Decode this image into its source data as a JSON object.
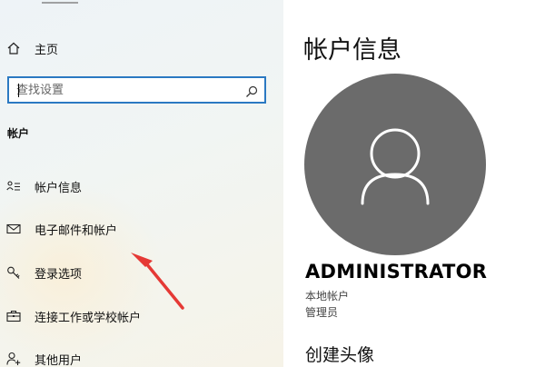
{
  "sidebar": {
    "home_label": "主页",
    "search": {
      "placeholder": "查找设置"
    },
    "section_title": "帐户",
    "items": [
      {
        "label": "帐户信息",
        "icon": "account-info-icon"
      },
      {
        "label": "电子邮件和帐户",
        "icon": "mail-icon"
      },
      {
        "label": "登录选项",
        "icon": "key-icon"
      },
      {
        "label": "连接工作或学校帐户",
        "icon": "briefcase-icon"
      },
      {
        "label": "其他用户",
        "icon": "add-user-icon"
      }
    ]
  },
  "main": {
    "title": "帐户信息",
    "user_name": "ADMINISTRATOR",
    "account_type": "本地帐户",
    "role": "管理员",
    "section_create_avatar": "创建头像"
  },
  "colors": {
    "accent": "#2b79c2",
    "avatar_bg": "#6b6b6b",
    "annotation_arrow": "#e53935"
  }
}
